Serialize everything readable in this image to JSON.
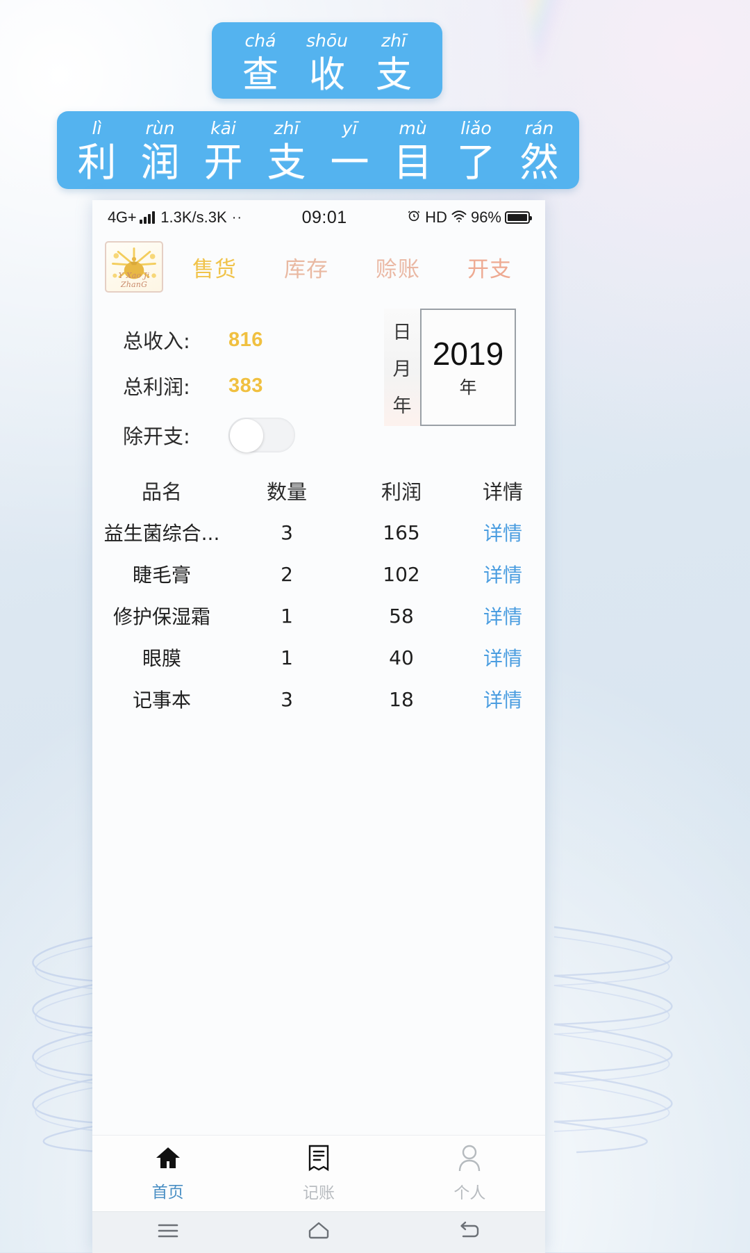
{
  "banners": [
    {
      "id": "banner-one",
      "cells": [
        {
          "pinyin": "chá",
          "hanzi": "查"
        },
        {
          "pinyin": "shōu",
          "hanzi": "收"
        },
        {
          "pinyin": "zhī",
          "hanzi": "支"
        }
      ]
    },
    {
      "id": "banner-two",
      "cells": [
        {
          "pinyin": "lì",
          "hanzi": "利"
        },
        {
          "pinyin": "rùn",
          "hanzi": "润"
        },
        {
          "pinyin": "kāi",
          "hanzi": "开"
        },
        {
          "pinyin": "zhī",
          "hanzi": "支"
        },
        {
          "pinyin": "yī",
          "hanzi": "一"
        },
        {
          "pinyin": "mù",
          "hanzi": "目"
        },
        {
          "pinyin": "liǎo",
          "hanzi": "了"
        },
        {
          "pinyin": "rán",
          "hanzi": "然"
        }
      ]
    }
  ],
  "statusbar": {
    "network": "4G+",
    "signal_icon": "signal-bars-icon",
    "speed": "1.3K/s.3K",
    "dots": "··",
    "time": "09:01",
    "alarm_icon": "alarm-clock-icon",
    "hd": "HD",
    "wifi_icon": "wifi-icon",
    "battery_pct": "96%",
    "battery_icon": "battery-icon"
  },
  "topbar": {
    "logo_text": "Y Xao Ji ZhanG",
    "logo_icon": "money-bag-logo-icon",
    "tabs": [
      {
        "label": "售货",
        "color": "#f0c34a",
        "active": true
      },
      {
        "label": "库存",
        "color": "#e9b9a2",
        "active": false
      },
      {
        "label": "赊账",
        "color": "#eab8a4",
        "active": false
      },
      {
        "label": "开支",
        "color": "#eeaa92",
        "active": false
      }
    ]
  },
  "summary": {
    "income_label": "总收入:",
    "income_value": "816",
    "profit_label": "总利润:",
    "profit_value": "383",
    "expense_label": "除开支:",
    "expense_toggle_state": "off",
    "value_color": "#f0c040"
  },
  "datepicker": {
    "options": [
      "日",
      "月",
      "年"
    ],
    "selected_value": "2019",
    "selected_unit": "年"
  },
  "table": {
    "headers": [
      "品名",
      "数量",
      "利润",
      "详情"
    ],
    "rows": [
      {
        "name": "益生菌综合...",
        "qty": "3",
        "profit": "165",
        "detail": "详情"
      },
      {
        "name": "睫毛膏",
        "qty": "2",
        "profit": "102",
        "detail": "详情"
      },
      {
        "name": "修护保湿霜",
        "qty": "1",
        "profit": "58",
        "detail": "详情"
      },
      {
        "name": "眼膜",
        "qty": "1",
        "profit": "40",
        "detail": "详情"
      },
      {
        "name": "记事本",
        "qty": "3",
        "profit": "18",
        "detail": "详情"
      }
    ],
    "detail_link_color": "#4a9de0"
  },
  "bottomnav": {
    "items": [
      {
        "label": "首页",
        "icon": "home-icon",
        "active": true
      },
      {
        "label": "记账",
        "icon": "receipt-icon",
        "active": false
      },
      {
        "label": "个人",
        "icon": "person-icon",
        "active": false
      }
    ],
    "active_color": "#4a8fc4",
    "inactive_color": "#b8bcc0"
  },
  "sysnav": {
    "buttons": [
      {
        "icon": "menu-icon"
      },
      {
        "icon": "home-outline-icon"
      },
      {
        "icon": "back-icon"
      }
    ]
  }
}
